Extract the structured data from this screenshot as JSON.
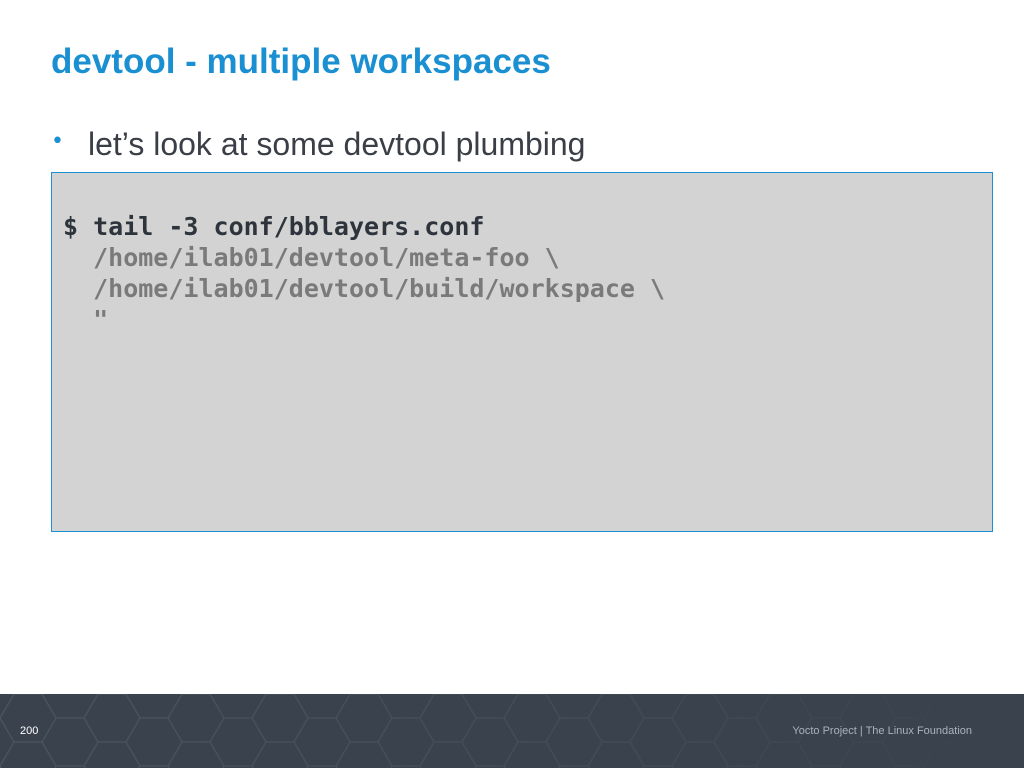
{
  "slide": {
    "title": "devtool - multiple workspaces",
    "bullet_symbol": "•",
    "bullet_text": "let’s look at some devtool plumbing"
  },
  "code": {
    "command": "$ tail -3 conf/bblayers.conf",
    "output_lines": [
      "  /home/ilab01/devtool/meta-foo \\",
      "  /home/ilab01/devtool/build/workspace \\",
      "  \""
    ]
  },
  "footer": {
    "page_number": "200",
    "credit": "Yocto Project | The Linux Foundation"
  },
  "colors": {
    "title": "#1a8fd1",
    "code_background": "#d3d3d3",
    "code_border": "#1a8fd1",
    "footer_background": "#3a434d"
  }
}
